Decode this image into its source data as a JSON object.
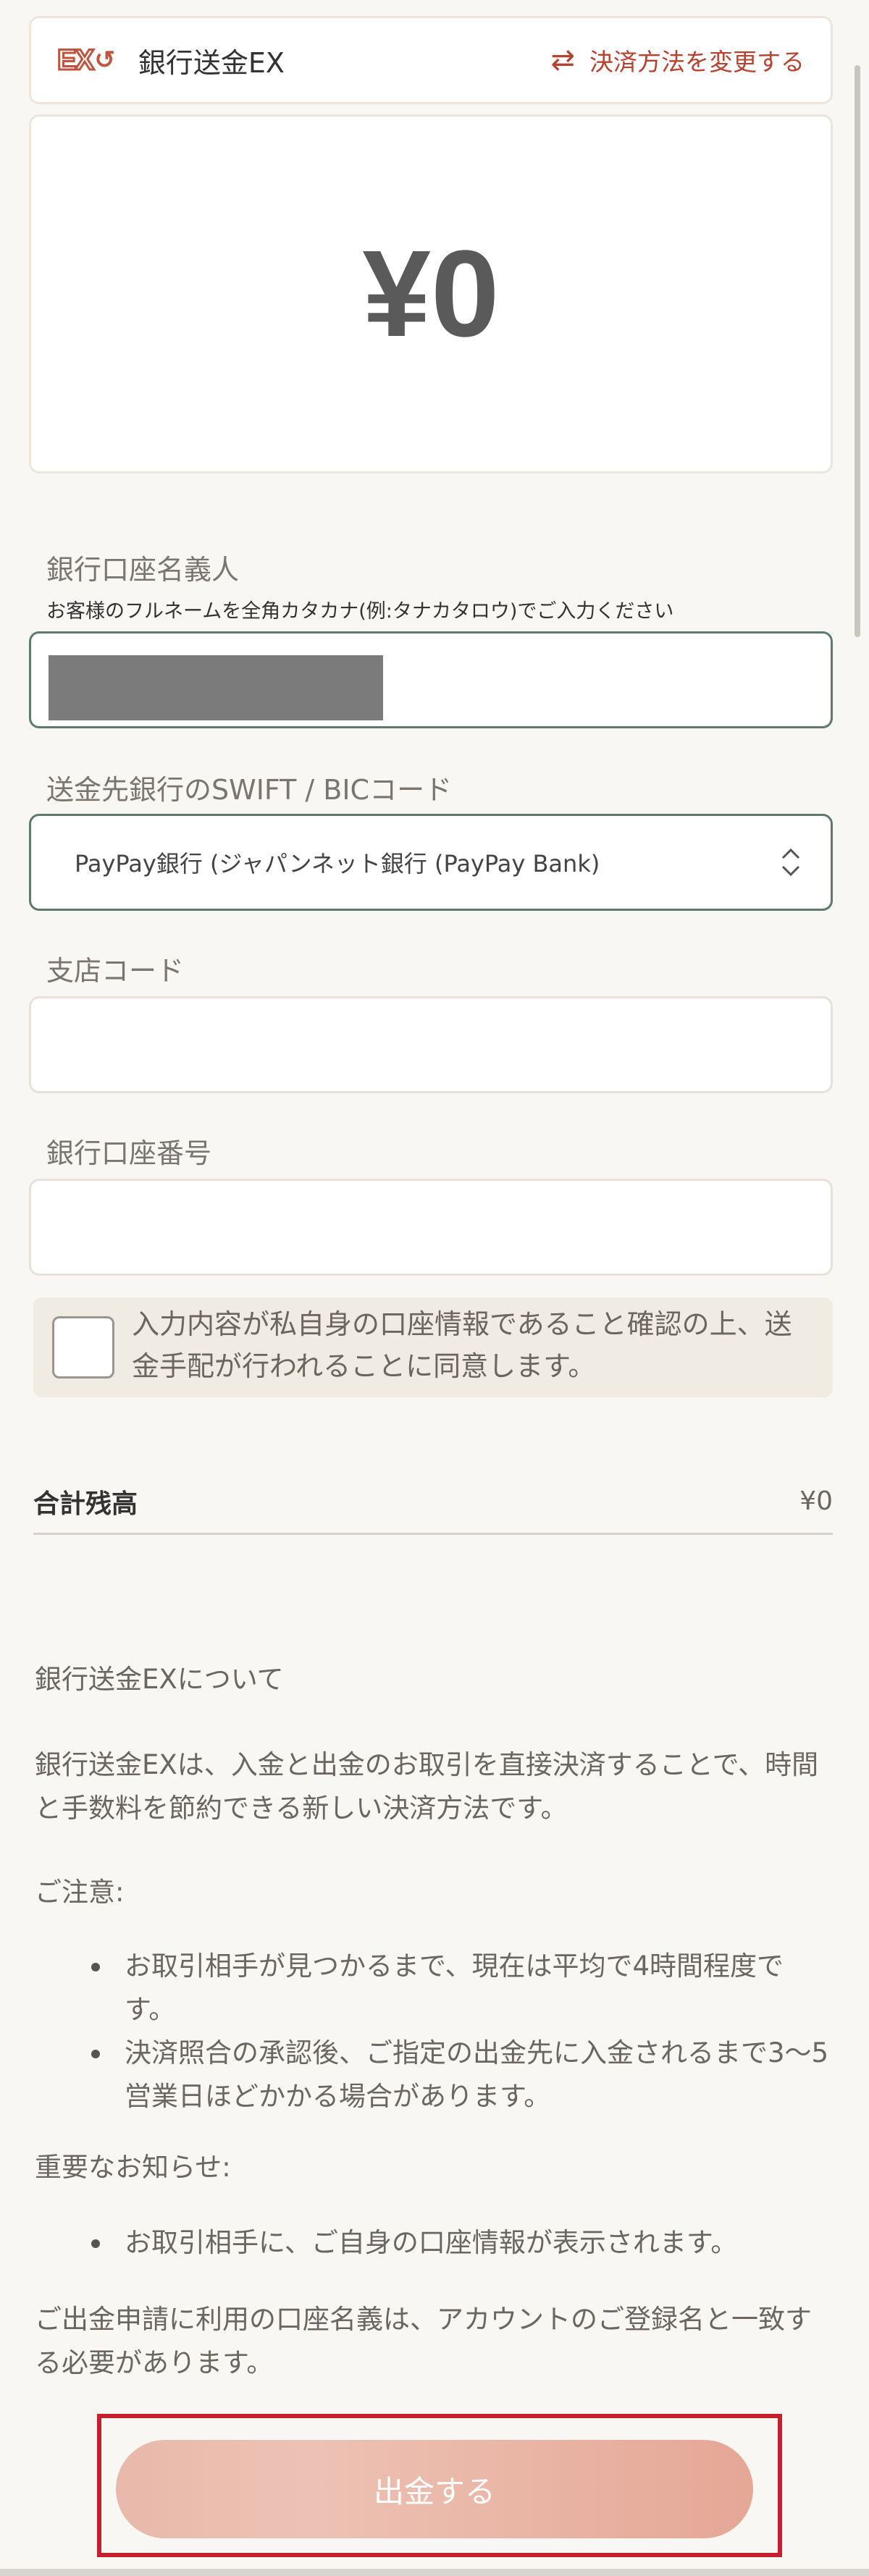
{
  "payment_method": {
    "logo_text": "EX",
    "name": "銀行送金EX",
    "change_label": "決済方法を変更する"
  },
  "amount": {
    "value": "¥0"
  },
  "form": {
    "account_holder": {
      "label": "銀行口座名義人",
      "hint": "お客様のフルネームを全角カタカナ(例:タナカタロウ)でご入力ください",
      "value": ""
    },
    "swift": {
      "label": "送金先銀行のSWIFT / BICコード",
      "selected": "PayPay銀行 (ジャパンネット銀行 (PayPay Bank)"
    },
    "branch_code": {
      "label": "支店コード",
      "value": ""
    },
    "account_number": {
      "label": "銀行口座番号",
      "value": ""
    },
    "consent": {
      "checked": false,
      "text": "入力内容が私自身の口座情報であること確認の上、送金手配が行われることに同意します。"
    }
  },
  "total": {
    "label": "合計残高",
    "value": "¥0"
  },
  "info": {
    "heading": "銀行送金EXについて",
    "description": "銀行送金EXは、入金と出金のお取引を直接決済することで、時間と手数料を節約できる新しい決済方法です。",
    "caution_heading": "ご注意:",
    "caution_items": [
      "お取引相手が見つかるまで、現在は平均で4時間程度です。",
      "決済照合の承認後、ご指定の出金先に入金されるまで3〜5営業日ほどかかる場合があります。"
    ],
    "notice_heading": "重要なお知らせ:",
    "notice_items": [
      "お取引相手に、ご自身の口座情報が表示されます。"
    ],
    "footer_note": "ご出金申請に利用の口座名義は、アカウントのご登録名と一致する必要があります。"
  },
  "submit": {
    "label": "出金する"
  },
  "colors": {
    "accent": "#b7422f",
    "highlight_border": "#c6202f",
    "button_gradient_start": "#e8b9ab",
    "button_gradient_end": "#e5a796"
  }
}
